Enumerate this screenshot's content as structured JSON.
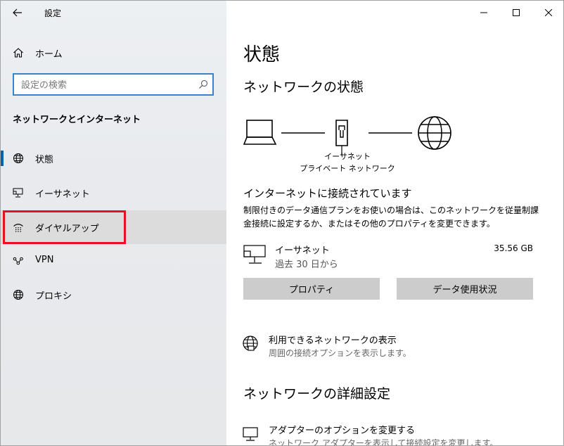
{
  "window": {
    "title": "設定"
  },
  "sidebar": {
    "home_label": "ホーム",
    "search": {
      "placeholder": "設定の検索"
    },
    "section_title": "ネットワークとインターネット",
    "items": [
      {
        "label": "状態",
        "icon": "globe-icon"
      },
      {
        "label": "イーサネット",
        "icon": "ethernet-icon"
      },
      {
        "label": "ダイヤルアップ",
        "icon": "dialup-icon"
      },
      {
        "label": "VPN",
        "icon": "vpn-icon"
      },
      {
        "label": "プロキシ",
        "icon": "globe-icon"
      }
    ]
  },
  "main": {
    "page_title": "状態",
    "network_status_heading": "ネットワークの状態",
    "diagram": {
      "line1": "イーサネット",
      "line2": "プライベート ネットワーク"
    },
    "connected_title": "インターネットに接続されています",
    "connected_desc": "制限付きのデータ通信プランをお使いの場合は、このネットワークを従量制課金接続に設定するか、またはその他のプロパティを変更できます。",
    "connection": {
      "name": "イーサネット",
      "since": "過去 30 日から",
      "usage": "35.56 GB"
    },
    "buttons": {
      "properties": "プロパティ",
      "data_usage": "データ使用状況"
    },
    "available_networks": {
      "title": "利用できるネットワークの表示",
      "sub": "周囲の接続オプションを表示します。"
    },
    "advanced_heading": "ネットワークの詳細設定",
    "adapter_options": {
      "title": "アダプターのオプションを変更する",
      "sub": "ネットワーク アダプターを表示して接続設定を変更します。"
    }
  }
}
